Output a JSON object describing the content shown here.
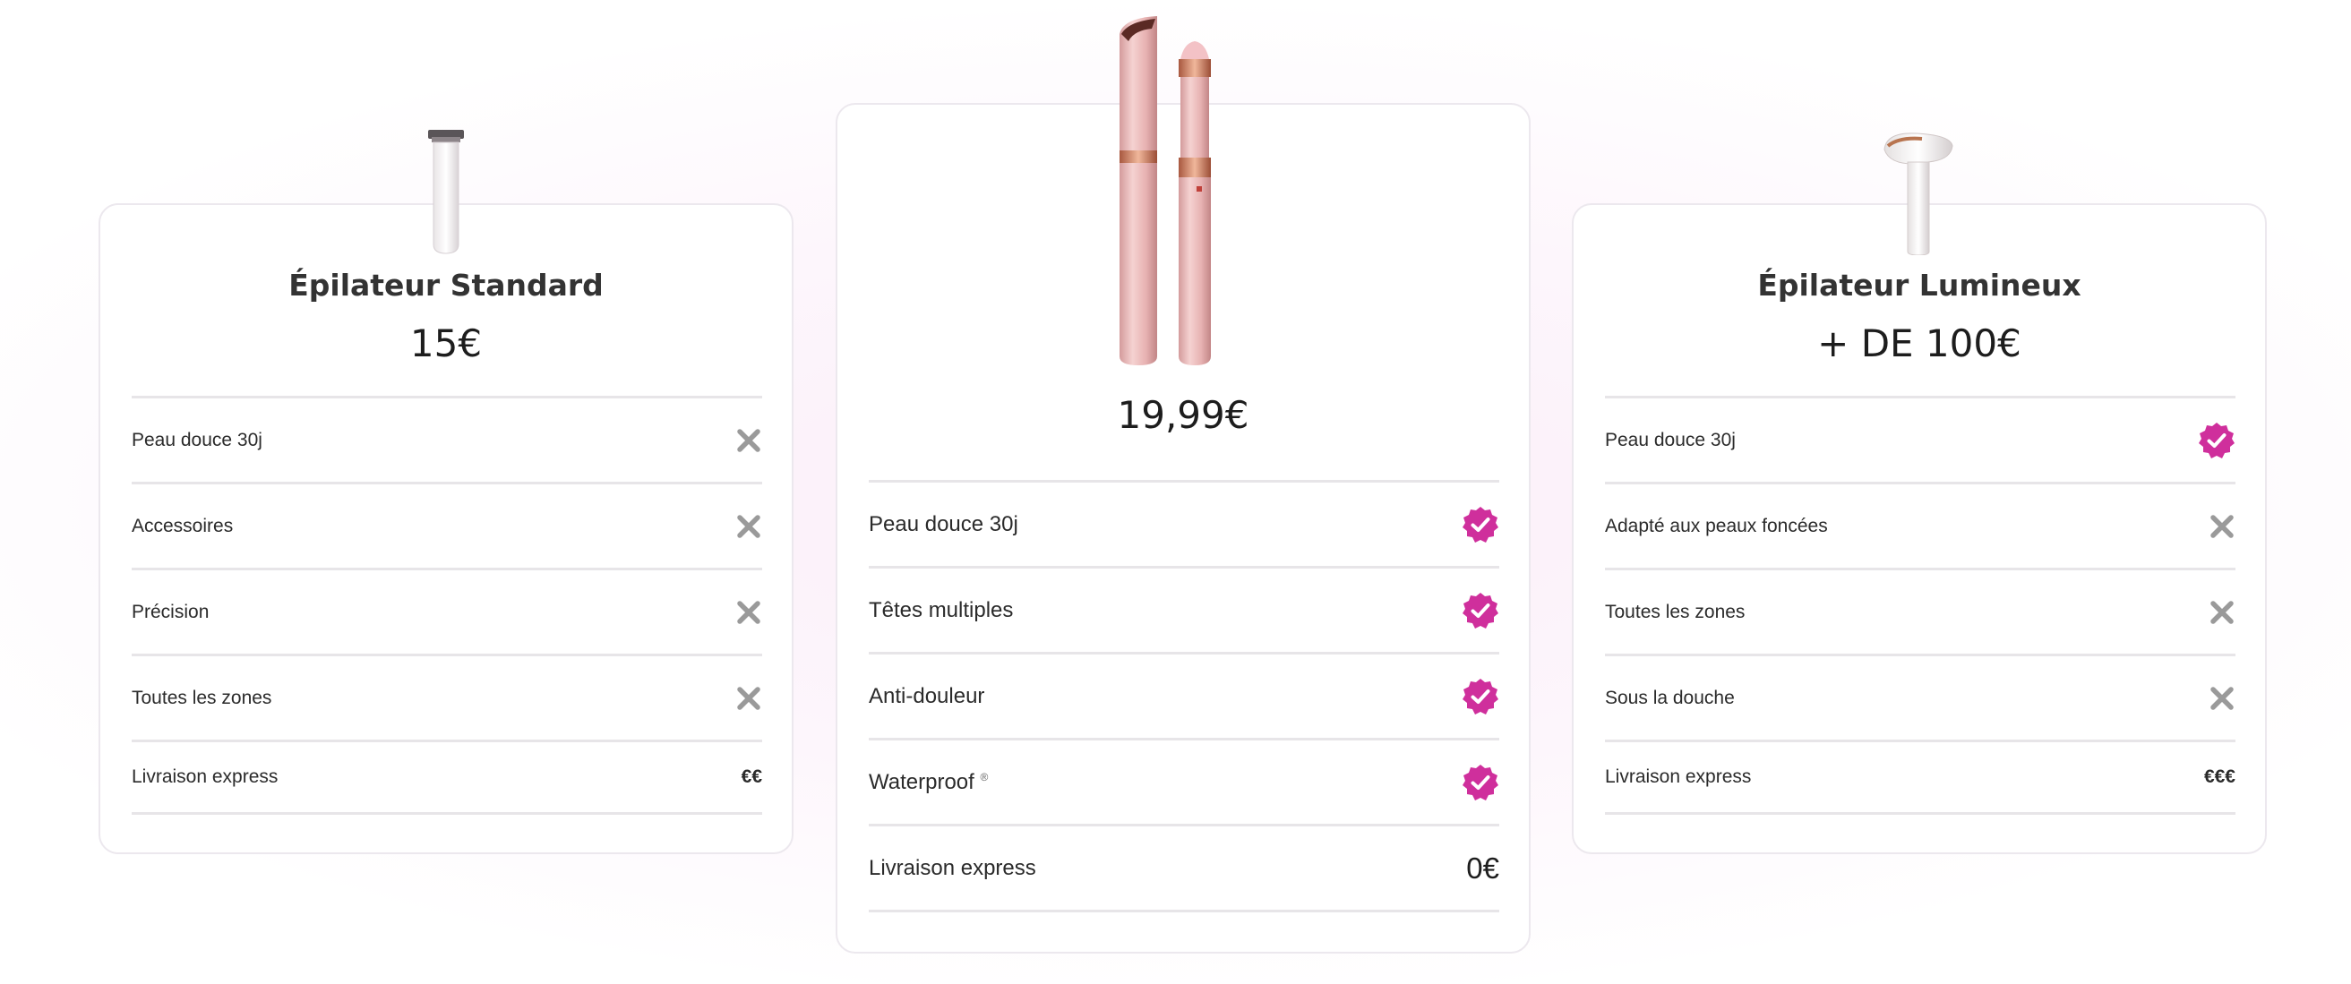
{
  "colors": {
    "accent": "#cf2f9c",
    "cross": "#9a9a9a",
    "divider": "#e7e5e8"
  },
  "cards": [
    {
      "title": "Épilateur Standard",
      "price": "15€",
      "rows": [
        {
          "label": "Peau douce 30j",
          "icon": "cross-icon"
        },
        {
          "label": "Accessoires",
          "icon": "cross-icon"
        },
        {
          "label": "Précision",
          "icon": "cross-icon"
        },
        {
          "label": "Toutes les zones",
          "icon": "cross-icon"
        },
        {
          "label": "Livraison express",
          "value": "€€"
        }
      ]
    },
    {
      "title": "",
      "price": "19,99€",
      "rows": [
        {
          "label": "Peau douce 30j",
          "icon": "check-badge-icon"
        },
        {
          "label": "Têtes multiples",
          "icon": "check-badge-icon"
        },
        {
          "label": "Anti-douleur",
          "icon": "check-badge-icon"
        },
        {
          "label": "Waterproof",
          "sup": "®",
          "icon": "check-badge-icon"
        },
        {
          "label": "Livraison express",
          "value": "0€"
        }
      ]
    },
    {
      "title": "Épilateur Lumineux",
      "price": "+ DE 100€",
      "rows": [
        {
          "label": "Peau douce 30j",
          "icon": "check-badge-icon"
        },
        {
          "label": "Adapté aux peaux foncées",
          "icon": "cross-icon"
        },
        {
          "label": "Toutes les zones",
          "icon": "cross-icon"
        },
        {
          "label": "Sous la douche",
          "icon": "cross-icon"
        },
        {
          "label": "Livraison express",
          "value": "€€€"
        }
      ]
    }
  ]
}
